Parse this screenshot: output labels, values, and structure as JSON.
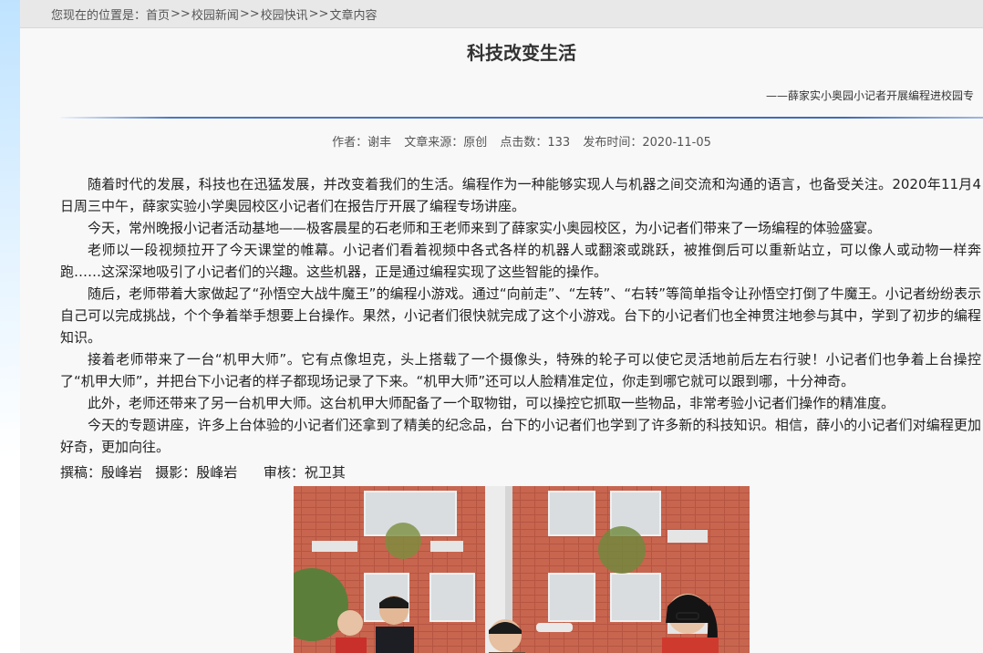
{
  "breadcrumb": {
    "prefix": "您现在的位置是：",
    "items": [
      "首页",
      "校园新闻",
      "校园快讯",
      "文章内容"
    ],
    "separator": ">>"
  },
  "article": {
    "title": "科技改变生活",
    "subtitle": "——薛家实小奥园小记者开展编程进校园专",
    "meta": {
      "author": "作者：谢丰",
      "source": "文章来源：原创",
      "clicks": "点击数：133",
      "published": "发布时间：2020-11-05"
    },
    "paragraphs": [
      "随着时代的发展，科技也在迅猛发展，并改变着我们的生活。编程作为一种能够实现人与机器之间交流和沟通的语言，也备受关注。2020年11月4日周三中午，薛家实验小学奥园校区小记者们在报告厅开展了编程专场讲座。",
      "今天，常州晚报小记者活动基地——极客晨星的石老师和王老师来到了薛家实小奥园校区，为小记者们带来了一场编程的体验盛宴。",
      "老师以一段视频拉开了今天课堂的帷幕。小记者们看着视频中各式各样的机器人或翻滚或跳跃，被推倒后可以重新站立，可以像人或动物一样奔跑……这深深地吸引了小记者们的兴趣。这些机器，正是通过编程实现了这些智能的操作。",
      "随后，老师带着大家做起了“孙悟空大战牛魔王”的编程小游戏。通过“向前走”、“左转”、“右转”等简单指令让孙悟空打倒了牛魔王。小记者纷纷表示自己可以完成挑战，个个争着举手想要上台操作。果然，小记者们很快就完成了这个小游戏。台下的小记者们也全神贯注地参与其中，学到了初步的编程知识。",
      "接着老师带来了一台“机甲大师”。它有点像坦克，头上搭载了一个摄像头，特殊的轮子可以使它灵活地前后左右行驶！小记者们也争着上台操控了“机甲大师”，并把台下小记者的样子都现场记录了下来。“机甲大师”还可以人脸精准定位，你走到哪它就可以跟到哪，十分神奇。",
      "此外，老师还带来了另一台机甲大师。这台机甲大师配备了一个取物钳，可以操控它抓取一些物品，非常考验小记者们操作的精准度。",
      "今天的专题讲座，许多上台体验的小记者们还拿到了精美的纪念品，台下的小记者们也学到了许多新的科技知识。相信，薛小的小记者们对编程更加好奇，更加向往。"
    ],
    "credits": "撰稿：殷峰岩   摄影：殷峰岩      审核：祝卫其"
  }
}
